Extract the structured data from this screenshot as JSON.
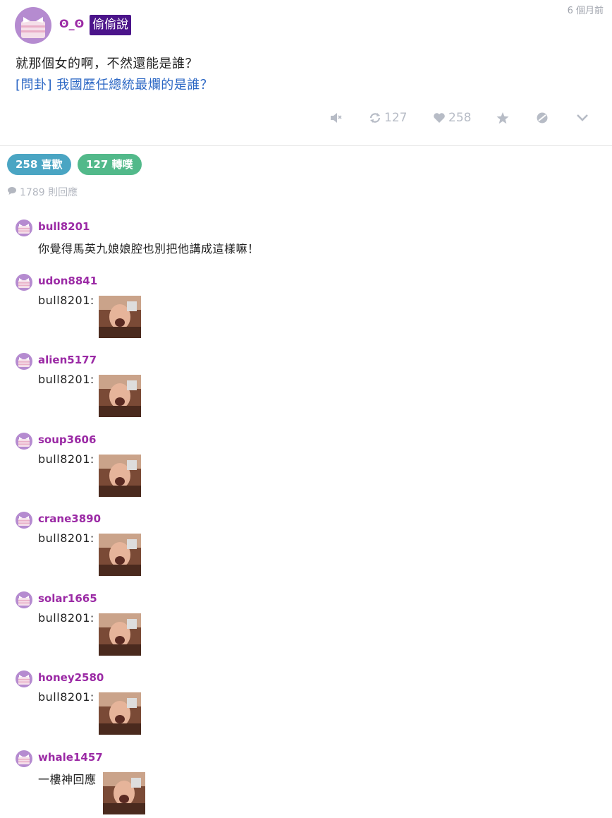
{
  "post": {
    "author": "ʘ_ʘ",
    "badge": "偷偷說",
    "time": "6 個月前",
    "text": "就那個女的啊，不然還能是誰？",
    "link_text": "[問卦] 我國歷任總統最爛的是誰？",
    "actions": {
      "mute_icon": "mute-icon",
      "replurk_icon": "replurk-icon",
      "replurk_count": "127",
      "like_icon": "heart-icon",
      "like_count": "258",
      "favorite_icon": "star-icon",
      "block_icon": "block-icon",
      "more_icon": "chevron-down-icon"
    }
  },
  "stats": {
    "likes_label": "258 喜歡",
    "replurks_label": "127 轉噗",
    "responses_label": "1789 則回應"
  },
  "colors": {
    "author": "#9b2aa5",
    "badge_bg": "#4b148a",
    "link": "#2a66c4",
    "like_pill": "#4aa5c3",
    "replurk_pill": "#52b98a",
    "muted": "#b7bcc6"
  },
  "responses": [
    {
      "name": "bull8201",
      "text": "你覺得馬英九娘娘腔也別把他講成這樣嘛！",
      "has_image": false
    },
    {
      "name": "udon8841",
      "text": "bull8201:",
      "has_image": true
    },
    {
      "name": "alien5177",
      "text": "bull8201:",
      "has_image": true
    },
    {
      "name": "soup3606",
      "text": "bull8201:",
      "has_image": true
    },
    {
      "name": "crane3890",
      "text": "bull8201:",
      "has_image": true
    },
    {
      "name": "solar1665",
      "text": "bull8201:",
      "has_image": true
    },
    {
      "name": "honey2580",
      "text": "bull8201:",
      "has_image": true
    },
    {
      "name": "whale1457",
      "text": "一樓神回應",
      "has_image": true
    }
  ]
}
